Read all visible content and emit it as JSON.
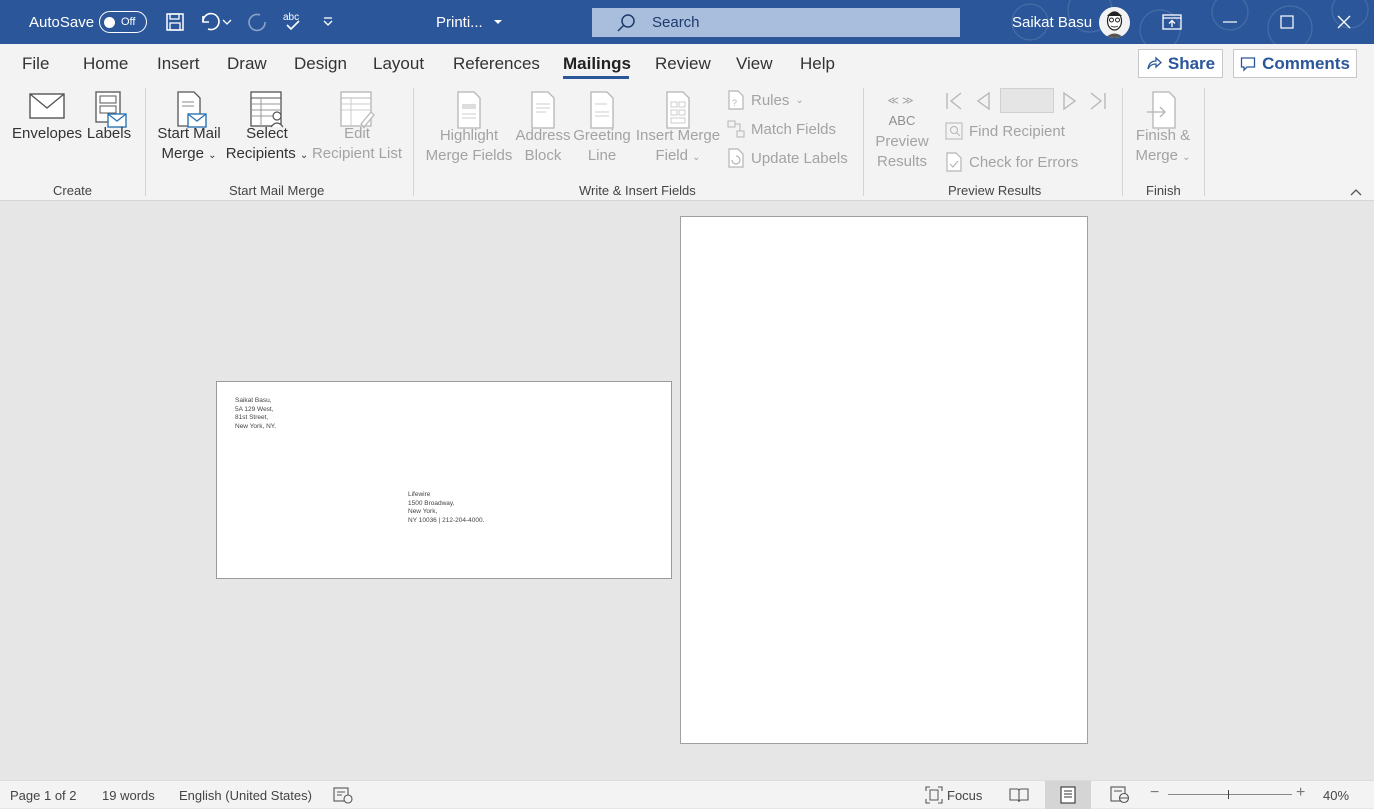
{
  "titlebar": {
    "autosave_label": "AutoSave",
    "autosave_state": "Off",
    "doc_title": "Printi...",
    "search_placeholder": "Search",
    "user_name": "Saikat Basu",
    "bg_color": "#2b579a"
  },
  "menu": {
    "items": [
      "File",
      "Home",
      "Insert",
      "Draw",
      "Design",
      "Layout",
      "References",
      "Mailings",
      "Review",
      "View",
      "Help"
    ],
    "active": "Mailings",
    "share_label": "Share",
    "comments_label": "Comments"
  },
  "ribbon": {
    "create": {
      "label": "Create",
      "envelopes": "Envelopes",
      "labels": "Labels"
    },
    "start_mail_merge": {
      "label": "Start Mail Merge",
      "start_line1": "Start Mail",
      "start_line2": "Merge",
      "select_line1": "Select",
      "select_line2": "Recipients",
      "edit_line1": "Edit",
      "edit_line2": "Recipient List"
    },
    "write_insert": {
      "label": "Write & Insert Fields",
      "highlight_line1": "Highlight",
      "highlight_line2": "Merge Fields",
      "address_line1": "Address",
      "address_line2": "Block",
      "greeting_line1": "Greeting",
      "greeting_line2": "Line",
      "insert_line1": "Insert Merge",
      "insert_line2": "Field",
      "rules": "Rules",
      "match_fields": "Match Fields",
      "update_labels": "Update Labels"
    },
    "preview": {
      "label": "Preview Results",
      "preview_icon_text": "ABC",
      "preview_line1": "Preview",
      "preview_line2": "Results",
      "find_recipient": "Find Recipient",
      "check_errors": "Check for Errors"
    },
    "finish": {
      "label": "Finish",
      "finish_line1": "Finish &",
      "finish_line2": "Merge"
    }
  },
  "envelope": {
    "return_address": [
      "Saikat Basu,",
      "5A 129 West,",
      "81st Street,",
      "New York, NY."
    ],
    "delivery_address": [
      "Lifewire",
      "1500 Broadway,",
      "New York,",
      "NY 10036 | 212-204-4000."
    ]
  },
  "statusbar": {
    "page": "Page 1 of 2",
    "words": "19 words",
    "language": "English (United States)",
    "focus": "Focus",
    "zoom": "40%"
  }
}
